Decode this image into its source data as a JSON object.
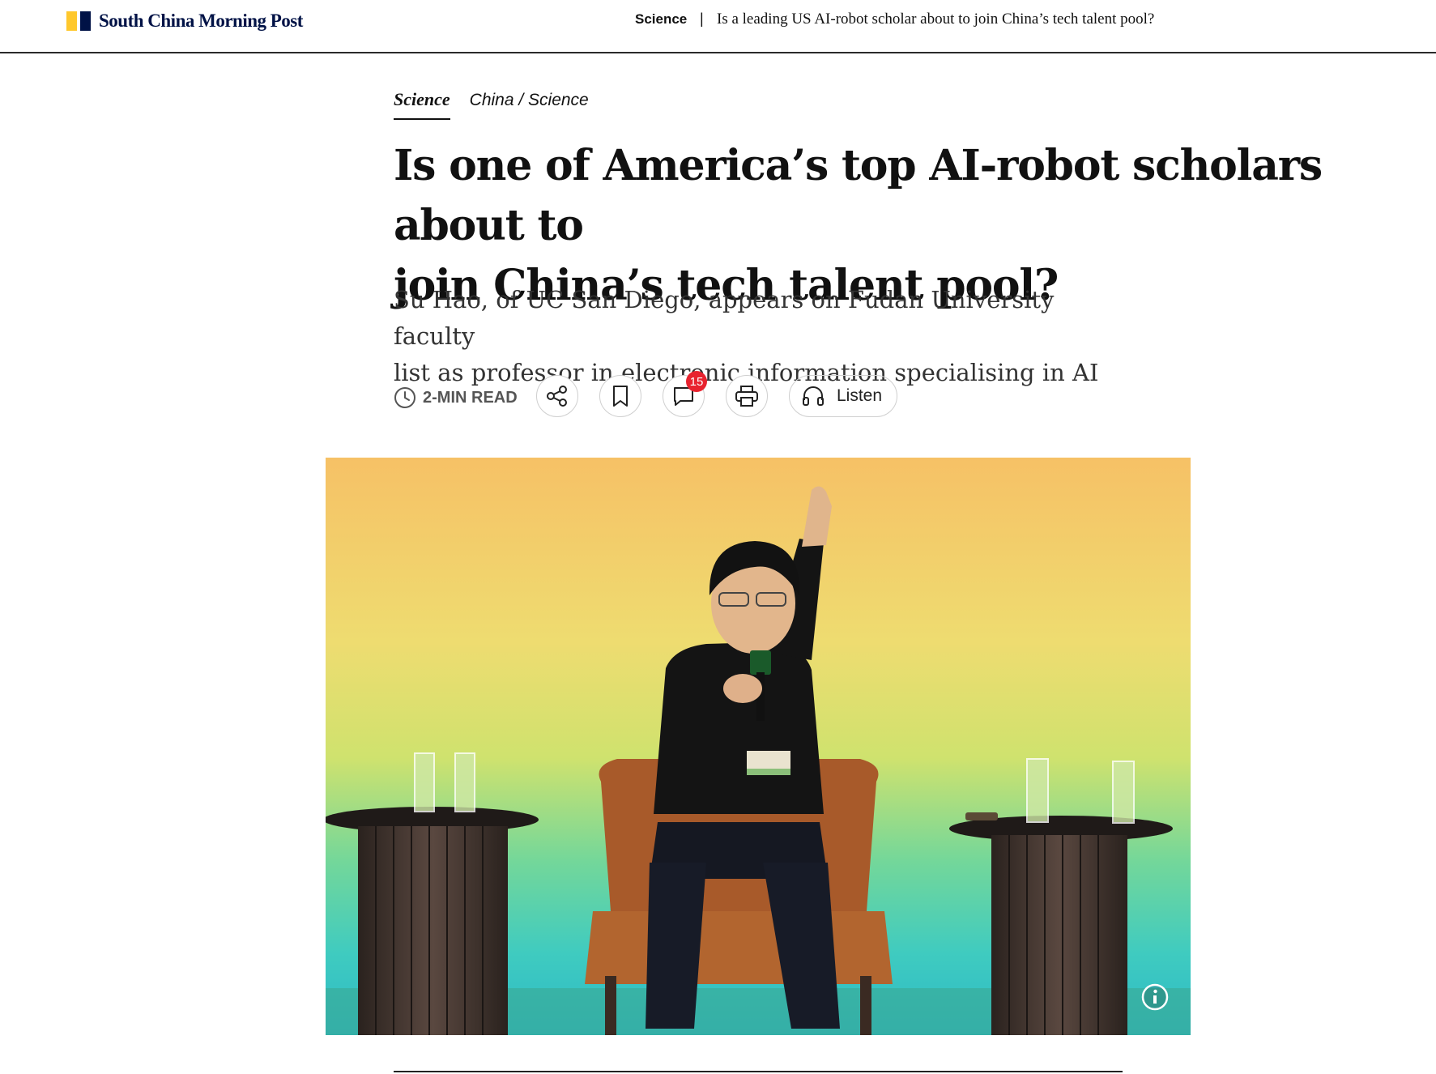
{
  "topbar": {
    "brand": "South China Morning Post",
    "section": "Science",
    "separator": "|",
    "headline": "Is a leading US AI-robot scholar about to join China’s tech talent pool?"
  },
  "breadcrumbs": {
    "primary": "Science",
    "secondary": "China / Science"
  },
  "article": {
    "headline_line1": "Is one of America’s top AI-robot scholars about to",
    "headline_line2": "join China’s tech talent pool?",
    "standfirst_line1": "Su Hao, of UC San Diego, appears on Fudan University faculty",
    "standfirst_line2": "list as professor in electronic information specialising in AI"
  },
  "actions": {
    "read_time": "2-MIN READ",
    "comment_count": "15",
    "listen_label": "Listen",
    "icons": [
      "clock-icon",
      "share-icon",
      "bookmark-icon",
      "comment-icon",
      "print-icon",
      "headphones-icon"
    ]
  },
  "photo": {
    "info_icon": "info-icon"
  },
  "colors": {
    "brand_yellow": "#ffc82c",
    "brand_navy": "#001246",
    "badge_red": "#e8232f"
  }
}
